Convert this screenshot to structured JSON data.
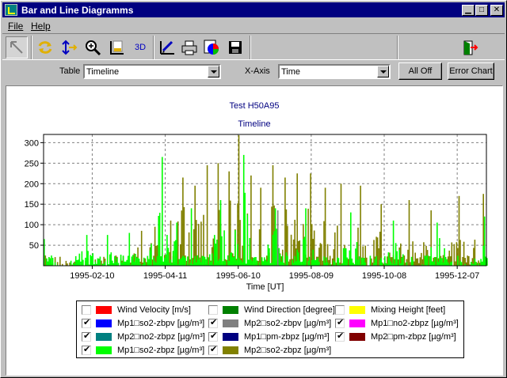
{
  "window": {
    "title": "Bar and Line Diagramms"
  },
  "menu": [
    "File",
    "Help"
  ],
  "toolbar": {
    "chart3d_label": "3D"
  },
  "controls": {
    "table_label": "Table",
    "table_value": "Timeline",
    "xaxis_label": "X-Axis",
    "xaxis_value": "Time",
    "alloff_label": "All Off",
    "errorchart_label": "Error Chart"
  },
  "chart_data": {
    "type": "bar",
    "title": "Test H50A95",
    "subtitle": "Timeline",
    "xlabel": "Time [UT]",
    "ylabel": "",
    "ylim": [
      0,
      320
    ],
    "yticks": [
      50,
      100,
      150,
      200,
      250,
      300
    ],
    "xticks": [
      "1995-02-10",
      "1995-04-11",
      "1995-06-10",
      "1995-08-09",
      "1995-10-08",
      "1995-12-07"
    ],
    "xrange": [
      "1995-01-01",
      "1995-12-31"
    ],
    "grid": true,
    "series": [
      {
        "name": "Mp2□so2-zbpz [µg/m³]",
        "color": "#808000",
        "peaks": [
          {
            "date": "1995-03-22",
            "value": 85
          },
          {
            "date": "1995-04-02",
            "value": 95
          },
          {
            "date": "1995-04-15",
            "value": 110
          },
          {
            "date": "1995-04-25",
            "value": 215
          },
          {
            "date": "1995-05-05",
            "value": 195
          },
          {
            "date": "1995-05-15",
            "value": 245
          },
          {
            "date": "1995-05-24",
            "value": 250
          },
          {
            "date": "1995-06-02",
            "value": 230
          },
          {
            "date": "1995-06-10",
            "value": 318
          },
          {
            "date": "1995-06-20",
            "value": 220
          },
          {
            "date": "1995-06-28",
            "value": 190
          },
          {
            "date": "1995-07-08",
            "value": 245
          },
          {
            "date": "1995-07-18",
            "value": 215
          },
          {
            "date": "1995-07-28",
            "value": 225
          },
          {
            "date": "1995-08-08",
            "value": 225
          },
          {
            "date": "1995-08-20",
            "value": 190
          },
          {
            "date": "1995-09-02",
            "value": 200
          },
          {
            "date": "1995-09-18",
            "value": 195
          },
          {
            "date": "1995-10-05",
            "value": 150
          },
          {
            "date": "1995-10-28",
            "value": 160
          },
          {
            "date": "1995-11-15",
            "value": 135
          },
          {
            "date": "1995-12-08",
            "value": 170
          },
          {
            "date": "1995-12-28",
            "value": 175
          }
        ]
      },
      {
        "name": "Mp1□so2-zbpz [µg/m³]",
        "color": "#00ff00",
        "peaks": [
          {
            "date": "1995-01-01",
            "value": 65
          },
          {
            "date": "1995-02-05",
            "value": 75
          },
          {
            "date": "1995-02-22",
            "value": 75
          },
          {
            "date": "1995-03-12",
            "value": 80
          },
          {
            "date": "1995-04-08",
            "value": 265
          },
          {
            "date": "1995-04-20",
            "value": 105
          },
          {
            "date": "1995-05-02",
            "value": 140
          },
          {
            "date": "1995-05-26",
            "value": 160
          },
          {
            "date": "1995-06-14",
            "value": 270
          },
          {
            "date": "1995-07-10",
            "value": 140
          },
          {
            "date": "1995-08-04",
            "value": 140
          },
          {
            "date": "1995-09-10",
            "value": 130
          },
          {
            "date": "1995-10-15",
            "value": 110
          },
          {
            "date": "1995-11-20",
            "value": 105
          },
          {
            "date": "1995-12-29",
            "value": 120
          }
        ]
      },
      {
        "name": "Mp2□so2-zbpv [µg/m³]",
        "color": "#808080",
        "peaks": [
          {
            "date": "1995-07-12",
            "value": 135
          }
        ]
      },
      {
        "name": "Mp2□no2-zbpz [µg/m³]",
        "color": "#008080",
        "peaks": []
      },
      {
        "name": "Mp1□so2-zbpv [µg/m³]",
        "color": "#0000ff",
        "peaks": []
      },
      {
        "name": "Mp1□pm-zbpz [µg/m³]",
        "color": "#000080",
        "peaks": []
      },
      {
        "name": "Mp1□no2-zbpz [µg/m³]",
        "color": "#ff00ff",
        "peaks": []
      },
      {
        "name": "Mp2□pm-zbpz [µg/m³]",
        "color": "#800000",
        "peaks": []
      }
    ]
  },
  "legend": [
    {
      "label": "Wind Velocity [m/s]",
      "color": "#ff0000",
      "checked": false
    },
    {
      "label": "Wind Direction [degree]",
      "color": "#008000",
      "checked": false
    },
    {
      "label": "Mixing Height [feet]",
      "color": "#ffff00",
      "checked": false
    },
    {
      "label": "Mp1□so2-zbpv [µg/m³]",
      "color": "#0000ff",
      "checked": true
    },
    {
      "label": "Mp2□so2-zbpv [µg/m³]",
      "color": "#808080",
      "checked": true
    },
    {
      "label": "Mp1□no2-zbpz [µg/m³]",
      "color": "#ff00ff",
      "checked": true
    },
    {
      "label": "Mp2□no2-zbpz [µg/m³]",
      "color": "#008080",
      "checked": true
    },
    {
      "label": "Mp1□pm-zbpz [µg/m³]",
      "color": "#000080",
      "checked": true
    },
    {
      "label": "Mp2□pm-zbpz [µg/m³]",
      "color": "#800000",
      "checked": true
    },
    {
      "label": "Mp1□so2-zbpz [µg/m³]",
      "color": "#00ff00",
      "checked": true
    },
    {
      "label": "Mp2□so2-zbpz [µg/m³]",
      "color": "#808000",
      "checked": true
    }
  ]
}
